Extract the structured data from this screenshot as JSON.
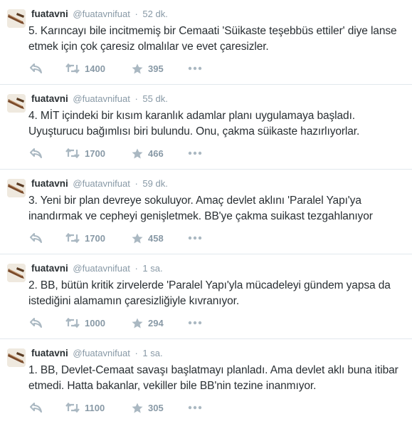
{
  "colors": {
    "name": "#292f33",
    "meta": "#8899a6",
    "icon": "#aab8c2",
    "divider": "#e1e8ed"
  },
  "icons": {
    "reply": "reply-arrow-icon",
    "retweet": "retweet-icon",
    "favorite": "star-icon",
    "more": "more-dots-icon"
  },
  "tweets": [
    {
      "fullname": "fuatavni",
      "username": "@fuatavnifuat",
      "dot": "·",
      "time": "52 dk.",
      "text": "5. Karıncayı bile incitmemiş bir Cemaati 'Süikaste teşebbüs ettiler' diye lanse etmek için çok çaresiz olmalılar ve evet çaresizler.",
      "retweets": "1400",
      "favorites": "395"
    },
    {
      "fullname": "fuatavni",
      "username": "@fuatavnifuat",
      "dot": "·",
      "time": "55 dk.",
      "text": "4. MİT içindeki bir kısım karanlık adamlar planı uygulamaya başladı. Uyuşturucu bağımlısı biri bulundu. Onu, çakma süikaste hazırlıyorlar.",
      "retweets": "1700",
      "favorites": "466"
    },
    {
      "fullname": "fuatavni",
      "username": "@fuatavnifuat",
      "dot": "·",
      "time": "59 dk.",
      "text": "3. Yeni bir plan devreye sokuluyor. Amaç devlet aklını 'Paralel Yapı'ya inandırmak ve cepheyi genişletmek. BB'ye çakma suikast tezgahlanıyor",
      "retweets": "1700",
      "favorites": "458"
    },
    {
      "fullname": "fuatavni",
      "username": "@fuatavnifuat",
      "dot": "·",
      "time": "1 sa.",
      "text": "2. BB, bütün kritik zirvelerde 'Paralel Yapı'yla mücadeleyi gündem yapsa da istediğini alamamın çaresizliğiyle kıvranıyor.",
      "retweets": "1000",
      "favorites": "294"
    },
    {
      "fullname": "fuatavni",
      "username": "@fuatavnifuat",
      "dot": "·",
      "time": "1 sa.",
      "text": "1. BB, Devlet-Cemaat savaşı başlatmayı planladı. Ama devlet aklı buna itibar etmedi. Hatta bakanlar, vekiller bile BB'nin tezine inanmıyor.",
      "retweets": "1100",
      "favorites": "305"
    }
  ]
}
